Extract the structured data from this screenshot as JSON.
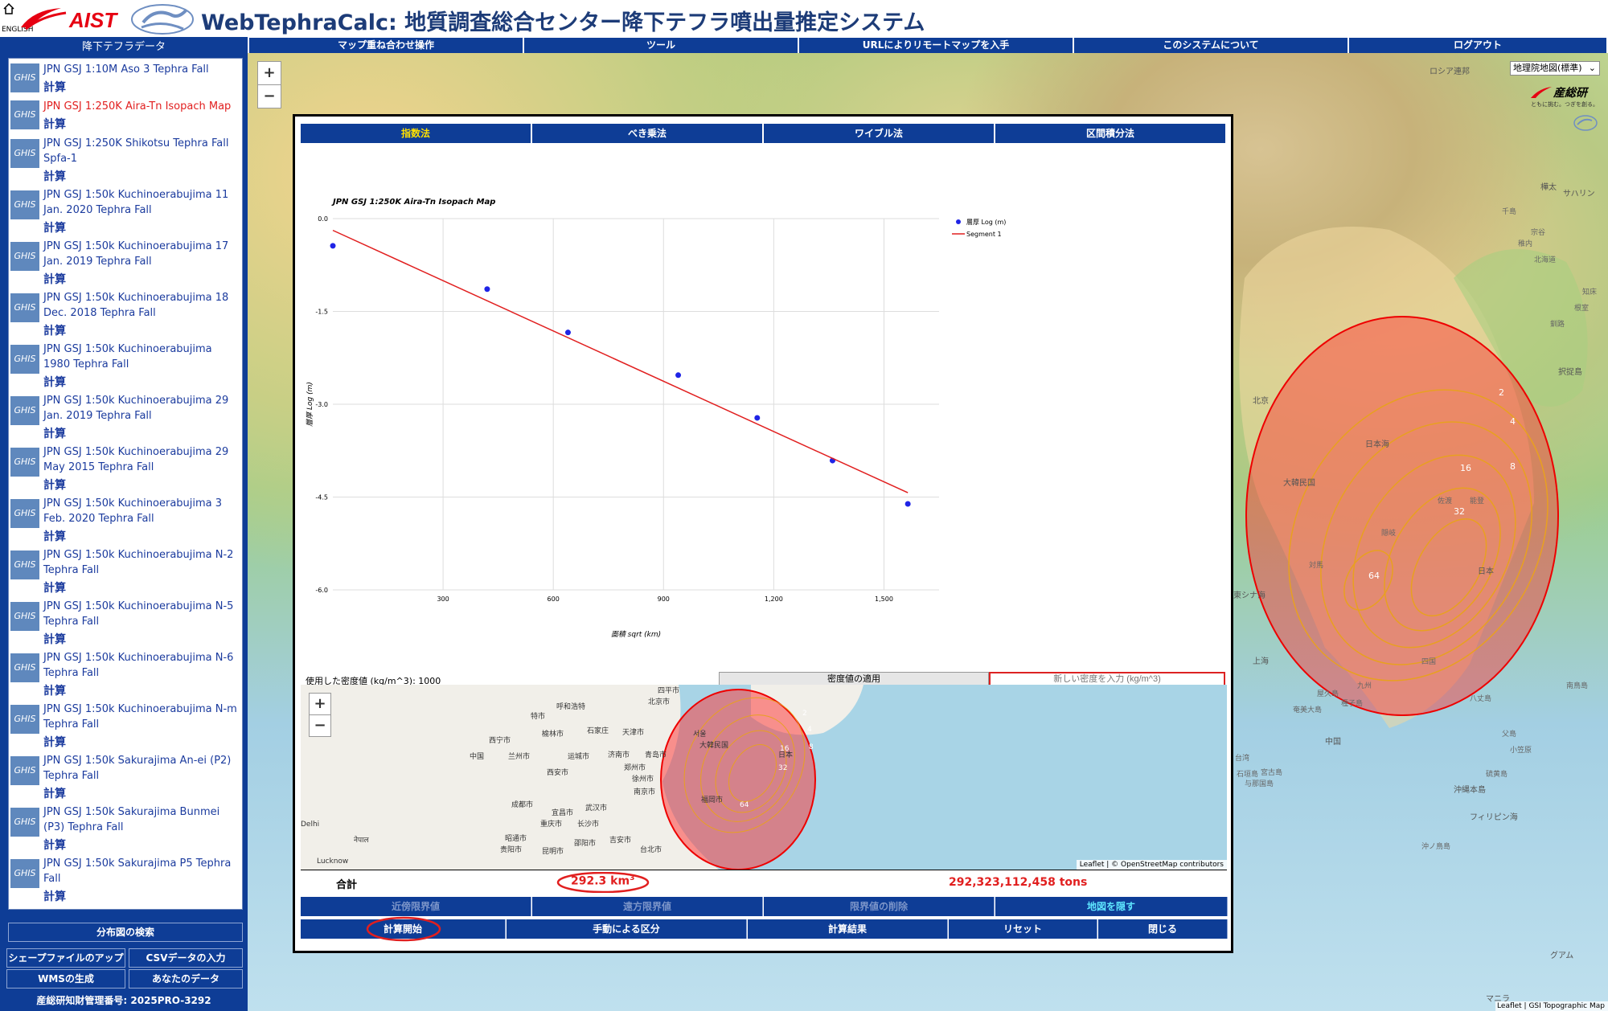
{
  "header": {
    "title": "WebTephraCalc: 地質調査総合センター降下テフラ噴出量推定システム",
    "lang_link": "ENGLISH",
    "logo_text": "AIST"
  },
  "sidebar": {
    "title": "降下テフラデータ",
    "ghis": "GHIS",
    "calc_label": "計算",
    "items": [
      {
        "name": "JPN GSJ 1:10M Aso 3 Tephra Fall"
      },
      {
        "name": "JPN GSJ 1:250K Aira-Tn Isopach Map"
      },
      {
        "name": "JPN GSJ 1:250K Shikotsu Tephra Fall Spfa-1"
      },
      {
        "name": "JPN GSJ 1:50k Kuchinoerabujima 11 Jan. 2020 Tephra Fall"
      },
      {
        "name": "JPN GSJ 1:50k Kuchinoerabujima 17 Jan. 2019 Tephra Fall"
      },
      {
        "name": "JPN GSJ 1:50k Kuchinoerabujima 18 Dec. 2018 Tephra Fall"
      },
      {
        "name": "JPN GSJ 1:50k Kuchinoerabujima 1980 Tephra Fall"
      },
      {
        "name": "JPN GSJ 1:50k Kuchinoerabujima 29 Jan. 2019 Tephra Fall"
      },
      {
        "name": "JPN GSJ 1:50k Kuchinoerabujima 29 May 2015 Tephra Fall"
      },
      {
        "name": "JPN GSJ 1:50k Kuchinoerabujima 3 Feb. 2020 Tephra Fall"
      },
      {
        "name": "JPN GSJ 1:50k Kuchinoerabujima N-2 Tephra Fall"
      },
      {
        "name": "JPN GSJ 1:50k Kuchinoerabujima N-5 Tephra Fall"
      },
      {
        "name": "JPN GSJ 1:50k Kuchinoerabujima N-6 Tephra Fall"
      },
      {
        "name": "JPN GSJ 1:50k Kuchinoerabujima N-m Tephra Fall"
      },
      {
        "name": "JPN GSJ 1:50k Sakurajima An-ei (P2) Tephra Fall"
      },
      {
        "name": "JPN GSJ 1:50k Sakurajima Bunmei (P3) Tephra Fall"
      },
      {
        "name": "JPN GSJ 1:50k Sakurajima P5 Tephra Fall"
      }
    ],
    "search_btn": "分布図の検索",
    "shape_btn": "シェープファイルのアップ",
    "csv_btn": "CSVデータの入力",
    "wms_btn": "WMSの生成",
    "yourdata_btn": "あなたのデータ",
    "license": "産総研知財管理番号: 2025PRO-3292"
  },
  "menu": [
    "マップ重ね合わせ操作",
    "ツール",
    "URLによりリモートマップを入手",
    "このシステムについて",
    "ログアウト"
  ],
  "map": {
    "layer_select": "地理院地図(標準)",
    "zoom_in": "+",
    "zoom_out": "−",
    "attribution": "Leaflet | GSI Topographic Map",
    "aist_mini": "産総研",
    "aist_mini_sub": "ともに挑む。つぎを創る。",
    "contours": [
      "2",
      "4",
      "8",
      "16",
      "32",
      "64"
    ],
    "labels": [
      "日本海",
      "日本",
      "東シナ海",
      "フィリピン海",
      "ロシア連邦",
      "中国",
      "大韓民国",
      "樺太",
      "サハリン",
      "択捉島",
      "沖縄本島",
      "グアム",
      "マニラ",
      "北京",
      "上海"
    ],
    "map_labels_small": [
      "千島",
      "北海道",
      "四国",
      "九州",
      "台湾",
      "与那国島",
      "南鳥島",
      "父島",
      "硫黄島",
      "沖ノ鳥島",
      "奄美大島",
      "屋久島",
      "種子島",
      "八丈島",
      "小笠原",
      "宮古島",
      "石垣島",
      "対馬",
      "佐渡",
      "隠岐",
      "能登",
      "知床",
      "根室",
      "釧路",
      "稚内",
      "宗谷"
    ]
  },
  "dialog": {
    "tabs": [
      "指数法",
      "べき乗法",
      "ワイブル法",
      "区間積分法"
    ],
    "density_label": "使用した密度値 (kg/m^3): 1000",
    "apply_density": "密度値の適用",
    "new_density_placeholder": "新しい密度を入力 (kg/m^3)",
    "total_label": "合計",
    "volume": "292.3 km",
    "volume_exp": "3",
    "mass": "292,323,112,458 tons",
    "row1": [
      "近傍限界値",
      "遠方限界値",
      "限界値の削除",
      "地図を隠す"
    ],
    "row2": [
      "計算開始",
      "手動による区分",
      "計算結果",
      "リセット",
      "閉じる"
    ]
  },
  "inset": {
    "zoom_in": "+",
    "zoom_out": "−",
    "attribution": "Leaflet | © OpenStreetMap contributors",
    "cities": [
      "四平市",
      "呼和浩特",
      "北京市",
      "特市",
      "榆林市",
      "石家庄",
      "天津市",
      "中国",
      "西宁市",
      "兰州市",
      "运城市",
      "济南市",
      "青岛市",
      "西安市",
      "郑州市",
      "徐州市",
      "南京市",
      "成都市",
      "宜昌市",
      "武汉市",
      "重庆市",
      "长沙市",
      "昭通市",
      "贵阳市",
      "昆明市",
      "邵阳市",
      "吉安市",
      "台北市",
      "Lucknow",
      "नेपाल",
      "Delhi",
      "서울",
      "大韓民国",
      "日本",
      "福岡市"
    ],
    "contours": [
      "2",
      "4",
      "8",
      "16",
      "32",
      "64"
    ]
  },
  "chart_data": {
    "type": "scatter",
    "title": "JPN GSJ 1:250K Aira-Tn Isopach Map",
    "xlabel": "面積 sqrt (km)",
    "ylabel": "層厚 Log (m)",
    "xlim": [
      0,
      1650
    ],
    "ylim": [
      -6.0,
      0.0
    ],
    "xticks": [
      300,
      600,
      900,
      1200,
      1500
    ],
    "xtick_labels": [
      "300",
      "600",
      "900",
      "1,200",
      "1,500"
    ],
    "yticks": [
      0.0,
      -1.5,
      -3.0,
      -4.5,
      -6.0
    ],
    "ytick_labels": [
      "0.0",
      "-1.5",
      "-3.0",
      "-4.5",
      "-6.0"
    ],
    "legend_position": "top-right",
    "series": [
      {
        "name": "層厚 Log (m)",
        "kind": "points",
        "color": "#1f24e6",
        "points": [
          [
            0,
            -0.44
          ],
          [
            420,
            -1.14
          ],
          [
            640,
            -1.84
          ],
          [
            940,
            -2.53
          ],
          [
            1155,
            -3.22
          ],
          [
            1360,
            -3.91
          ],
          [
            1565,
            -4.61
          ]
        ]
      },
      {
        "name": "Segment 1",
        "kind": "line",
        "color": "#e11f1f",
        "points": [
          [
            0,
            -0.19
          ],
          [
            1565,
            -4.43
          ]
        ]
      }
    ]
  }
}
